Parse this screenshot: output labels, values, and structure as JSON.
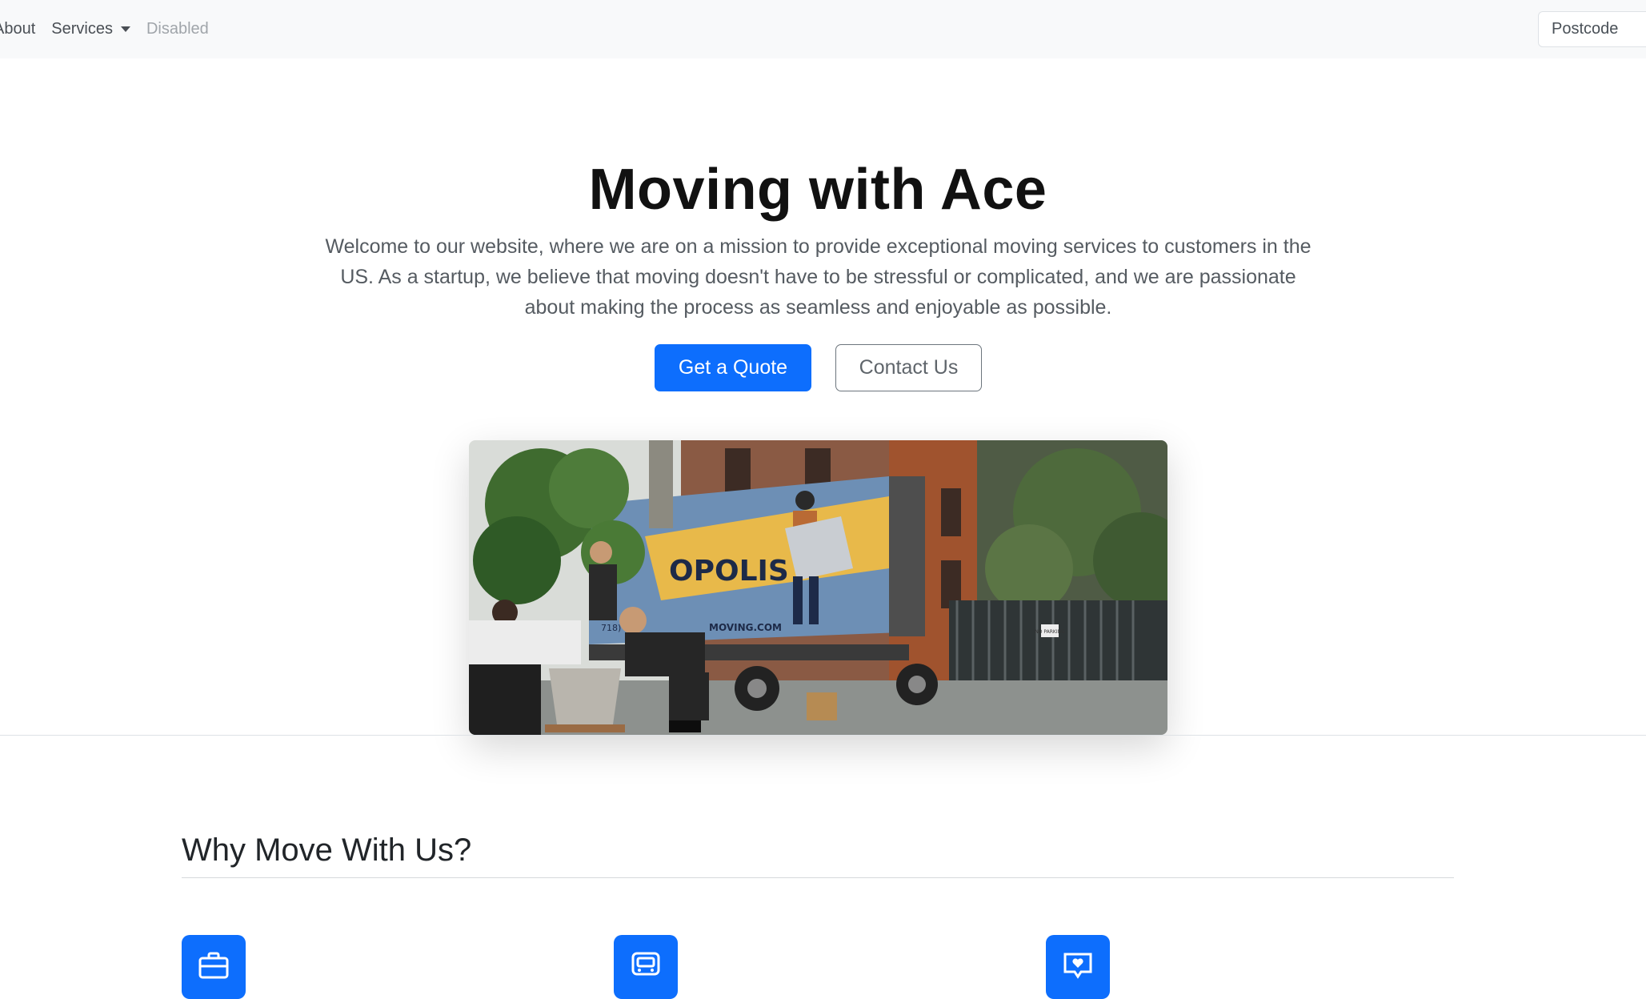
{
  "navbar": {
    "links": [
      "About",
      "Services",
      "Disabled"
    ],
    "postcode_placeholder": "Postcode"
  },
  "hero": {
    "title": "Moving with Ace",
    "text": "Welcome to our website, where we are on a mission to provide exceptional moving services to customers in the US. As a startup, we believe that moving doesn't have to be stressful or complicated, and we are passionate about making the process as seamless and enjoyable as possible.",
    "primary_button": "Get a Quote",
    "secondary_button": "Contact Us",
    "image": {
      "truck_text_1": "OPOLIS",
      "truck_text_2": "MOVING.COM",
      "truck_text_3": "718) 320",
      "sign_text": "NO PARKING"
    }
  },
  "features": {
    "title": "Why Move With Us?",
    "icons": [
      "briefcase-icon",
      "bus-icon",
      "chat-heart-icon"
    ]
  },
  "colors": {
    "primary": "#0d6efd",
    "navbar_bg": "#f8f9fa"
  }
}
